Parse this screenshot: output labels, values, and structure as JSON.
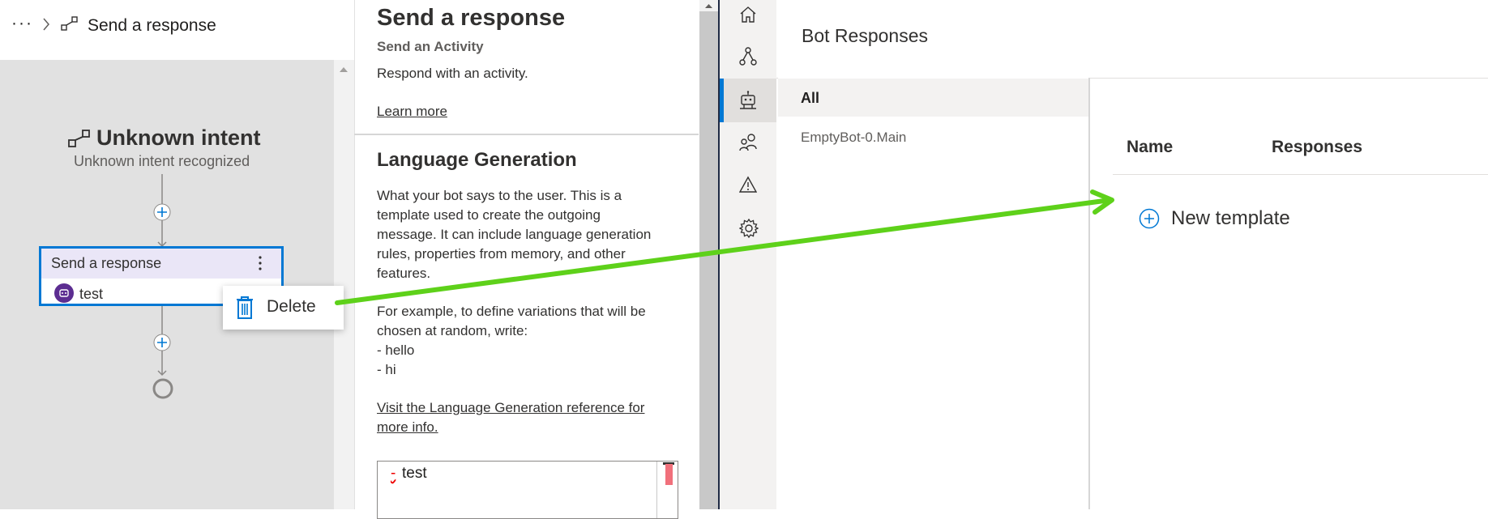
{
  "left_pane": {
    "breadcrumb": {
      "ellipsis": "···",
      "current": "Send a response"
    },
    "trigger": {
      "title": "Unknown intent",
      "subtitle": "Unknown intent recognized"
    },
    "action_card": {
      "title": "Send a response",
      "body": "test"
    },
    "context_menu": {
      "delete_label": "Delete"
    }
  },
  "property_pane": {
    "title": "Send a response",
    "subtitle": "Send an Activity",
    "description": "Respond with an activity.",
    "learn_more": "Learn more",
    "lg_section_title": "Language Generation",
    "lg_description": [
      "What your bot says to the user. This is a",
      "template used to create the outgoing",
      "message. It can include language generation",
      "rules, properties from memory, and other",
      "features."
    ],
    "lg_example": [
      "For example, to define variations that will be",
      "chosen at random, write:",
      "- hello",
      "- hi"
    ],
    "lg_reference_link": [
      "Visit the Language Generation reference for",
      "more info."
    ],
    "editor": {
      "dash": "-",
      "value": "test"
    }
  },
  "nav": {
    "items": [
      "home-icon",
      "flow-icon",
      "bot-icon",
      "users-icon",
      "warning-icon",
      "gear-icon"
    ],
    "active": "bot-icon"
  },
  "bot_responses": {
    "title": "Bot Responses",
    "list": {
      "all": "All",
      "items": [
        "EmptyBot-0.Main"
      ]
    },
    "columns": {
      "name": "Name",
      "responses": "Responses"
    },
    "new_template": "New template"
  },
  "colors": {
    "accent": "#0078d4",
    "arrow": "#5ed11a",
    "bot_badge": "#5c2d91"
  }
}
